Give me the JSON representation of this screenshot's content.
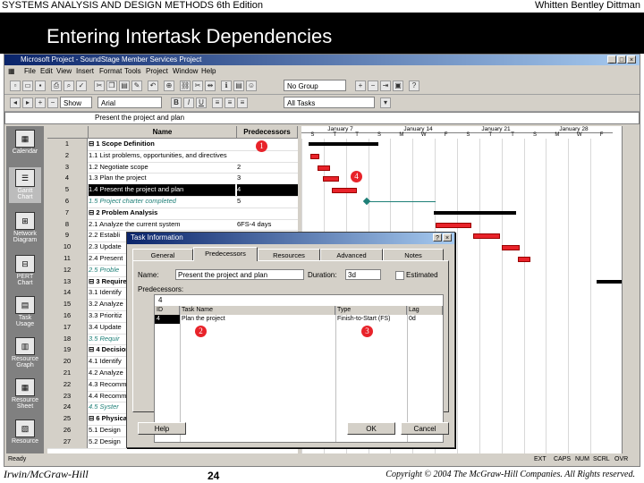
{
  "slide": {
    "header_left": "SYSTEMS ANALYSIS AND DESIGN METHODS  6th Edition",
    "header_right": "Whitten  Bentley  Dittman",
    "title": "Entering Intertask Dependencies",
    "footer_left": "Irwin/McGraw-Hill",
    "footer_page": "24",
    "footer_right": "Copyright © 2004 The McGraw-Hill Companies. All Rights reserved."
  },
  "app": {
    "window_title": "Microsoft Project - SoundStage Member Services Project",
    "menu": [
      "File",
      "Edit",
      "View",
      "Insert",
      "Format",
      "Tools",
      "Project",
      "Window",
      "Help"
    ],
    "group_select": "No Group",
    "font_select": "Arial",
    "show_label": "Show",
    "filter_select": "All Tasks",
    "edit_bar_value": "Present the project and plan",
    "status_text": "Ready",
    "status_flags": [
      "EXT",
      "CAPS",
      "NUM",
      "SCRL",
      "OVR"
    ]
  },
  "view_bar": [
    "Calendar",
    "Gantt Chart",
    "Network Diagram",
    "PERT Chart",
    "Task Usage",
    "Resource Graph",
    "Resource Sheet",
    "Resource"
  ],
  "table": {
    "col_name": "Name",
    "col_pred": "Predecessors",
    "rows": [
      {
        "id": "1",
        "name": "⊟ 1 Scope Definition",
        "pred": "",
        "type": "sum"
      },
      {
        "id": "2",
        "name": "1.1 List problems, opportunities, and directives",
        "pred": "",
        "type": ""
      },
      {
        "id": "3",
        "name": "1.2 Negotiate scope",
        "pred": "2",
        "type": ""
      },
      {
        "id": "4",
        "name": "1.3 Plan the project",
        "pred": "3",
        "type": ""
      },
      {
        "id": "5",
        "name": "1.4 Present the project and plan",
        "pred": "4",
        "type": "sel"
      },
      {
        "id": "6",
        "name": "1.5 Project charter completed",
        "pred": "5",
        "type": "ms"
      },
      {
        "id": "7",
        "name": "⊟ 2 Problem Analysis",
        "pred": "",
        "type": "sum"
      },
      {
        "id": "8",
        "name": "2.1 Analyze the current system",
        "pred": "6FS-4 days",
        "type": ""
      },
      {
        "id": "9",
        "name": "2.2 Establi",
        "pred": "",
        "type": ""
      },
      {
        "id": "10",
        "name": "2.3 Update",
        "pred": "",
        "type": ""
      },
      {
        "id": "11",
        "name": "2.4 Present",
        "pred": "",
        "type": ""
      },
      {
        "id": "12",
        "name": "2.5 Proble",
        "pred": "",
        "type": "ms"
      },
      {
        "id": "13",
        "name": "⊟ 3 Requiremen",
        "pred": "",
        "type": "sum"
      },
      {
        "id": "14",
        "name": "3.1 Identify",
        "pred": "",
        "type": ""
      },
      {
        "id": "15",
        "name": "3.2 Analyze",
        "pred": "",
        "type": ""
      },
      {
        "id": "16",
        "name": "3.3 Prioritiz",
        "pred": "",
        "type": ""
      },
      {
        "id": "17",
        "name": "3.4 Update",
        "pred": "",
        "type": ""
      },
      {
        "id": "18",
        "name": "3.5 Requir",
        "pred": "",
        "type": "ms"
      },
      {
        "id": "19",
        "name": "⊟ 4 Decision Ana",
        "pred": "",
        "type": "sum"
      },
      {
        "id": "20",
        "name": "4.1 Identify",
        "pred": "",
        "type": ""
      },
      {
        "id": "21",
        "name": "4.2 Analyze",
        "pred": "",
        "type": ""
      },
      {
        "id": "22",
        "name": "4.3 Recomm",
        "pred": "",
        "type": ""
      },
      {
        "id": "23",
        "name": "4.4 Recomm",
        "pred": "",
        "type": ""
      },
      {
        "id": "24",
        "name": "4.5 Syster",
        "pred": "",
        "type": "ms"
      },
      {
        "id": "25",
        "name": "⊟ 6 Physical Des",
        "pred": "",
        "type": "sum"
      },
      {
        "id": "26",
        "name": "5.1 Design",
        "pred": "",
        "type": ""
      },
      {
        "id": "27",
        "name": "5.2 Design",
        "pred": "",
        "type": ""
      }
    ]
  },
  "gantt": {
    "weeks": [
      "January 7",
      "January 14",
      "January 21",
      "January 28"
    ],
    "days": [
      "S",
      "T",
      "T",
      "S",
      "M",
      "W",
      "F",
      "S",
      "T",
      "T",
      "S",
      "M",
      "W",
      "F"
    ]
  },
  "callouts": [
    "1",
    "2",
    "3",
    "4"
  ],
  "dialog": {
    "title": "Task Information",
    "tabs": [
      "General",
      "Predecessors",
      "Resources",
      "Advanced",
      "Notes"
    ],
    "name_label": "Name:",
    "name_value": "Present the project and plan",
    "duration_label": "Duration:",
    "duration_value": "3d",
    "estimated_label": "Estimated",
    "pred_label": "Predecessors:",
    "grid_input": "4",
    "grid_headers": [
      "ID",
      "Task Name",
      "Type",
      "Lag"
    ],
    "grid_row": {
      "id": "4",
      "name": "Plan the project",
      "type": "Finish-to-Start (FS)",
      "lag": "0d"
    },
    "help": "Help",
    "ok": "OK",
    "cancel": "Cancel"
  }
}
